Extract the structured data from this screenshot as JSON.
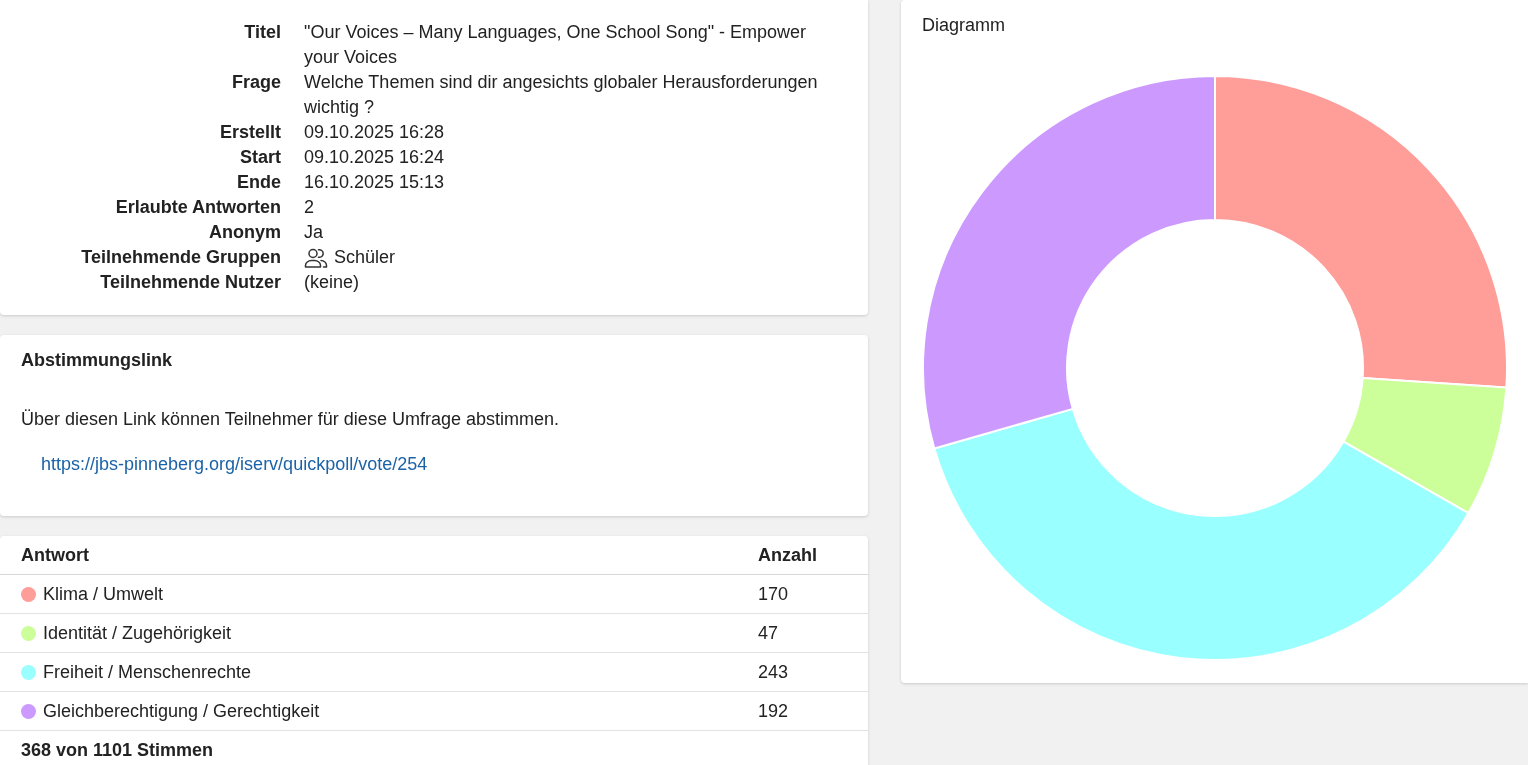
{
  "details": {
    "rows": [
      {
        "label": "Titel",
        "value": "\"Our Voices – Many Languages, One School Song\" - Empower your Voices",
        "kind": "text"
      },
      {
        "label": "Frage",
        "value": "Welche Themen sind dir angesichts globaler Herausforderungen wichtig ?",
        "kind": "text"
      },
      {
        "label": "Erstellt",
        "value": "09.10.2025 16:28",
        "kind": "text"
      },
      {
        "label": "Start",
        "value": "09.10.2025 16:24",
        "kind": "text"
      },
      {
        "label": "Ende",
        "value": "16.10.2025 15:13",
        "kind": "text"
      },
      {
        "label": "Erlaubte Antworten",
        "value": "2",
        "kind": "text"
      },
      {
        "label": "Anonym",
        "value": "Ja",
        "kind": "text"
      },
      {
        "label": "Teilnehmende Gruppen",
        "value": "Schüler",
        "kind": "group"
      },
      {
        "label": "Teilnehmende Nutzer",
        "value": "(keine)",
        "kind": "text"
      }
    ]
  },
  "vote_link": {
    "title": "Abstimmungslink",
    "text": "Über diesen Link können Teilnehmer für diese Umfrage abstimmen.",
    "url": "https://jbs-pinneberg.org/iserv/quickpoll/vote/254"
  },
  "results": {
    "columns": [
      "Antwort",
      "Anzahl"
    ],
    "rows": [
      {
        "answer": "Klima / Umwelt",
        "count": "170",
        "color": "#ff9d99"
      },
      {
        "answer": "Identität / Zugehörigkeit",
        "count": "47",
        "color": "#ccff99"
      },
      {
        "answer": "Freiheit / Menschenrechte",
        "count": "243",
        "color": "#99ffff"
      },
      {
        "answer": "Gleichberechtigung / Gerechtigkeit",
        "count": "192",
        "color": "#cc99ff"
      }
    ],
    "footer": "368 von 1101 Stimmen"
  },
  "chart": {
    "title": "Diagramm",
    "chart_data": {
      "type": "donut",
      "values": [
        26.07,
        7.21,
        37.27,
        29.45
      ]
    }
  }
}
